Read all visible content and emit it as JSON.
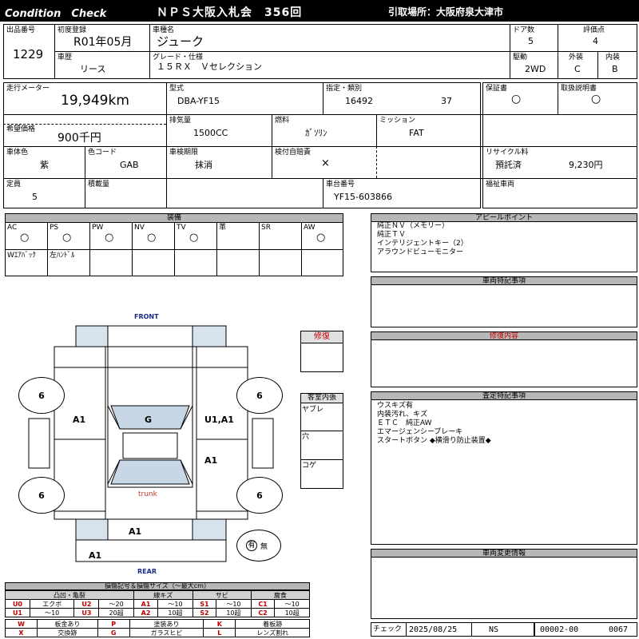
{
  "header": {
    "left": "Condition　Check",
    "center": "ＮＰＳ大阪入札会　356回",
    "right": "引取場所：大阪府泉大津市"
  },
  "info": {
    "lot_label": "出品番号",
    "lot": "1229",
    "first_reg_label": "初度登録",
    "first_reg": "R01年05月",
    "car_name_label": "車種名",
    "car_name": "ジューク",
    "doors_label": "ドア数",
    "doors": "5",
    "grade_score_label": "評価点",
    "grade_score": "4",
    "history_label": "車歴",
    "history": "リース",
    "grade_label": "グレード・仕様",
    "grade": "１５ＲＸ　Ｖセレクション",
    "drive_label": "駆動",
    "drive": "2WD",
    "exterior_label": "外装",
    "exterior": "C",
    "interior_label": "内装",
    "interior": "B",
    "mileage_label": "走行メーター",
    "mileage": "19,949km",
    "model_label": "型式",
    "model": "DBA-YF15",
    "designation_label": "指定・類別",
    "designation": "16492",
    "category": "37",
    "warranty_label": "保証書",
    "warranty": "○",
    "manual_label": "取扱説明書",
    "manual": "○",
    "price_label": "希望価格",
    "price": "900千円",
    "displacement_label": "排気量",
    "displacement": "1500CC",
    "fuel_label": "燃料",
    "fuel": "ｶﾞｿﾘﾝ",
    "mission_label": "ミッション",
    "mission": "FAT",
    "color_label": "車体色",
    "color": "紫",
    "color_code_label": "色コード",
    "color_code": "GAB",
    "inspection_label": "車検期限",
    "inspection": "抹消",
    "liability_label": "検付自賠責",
    "liability": "×",
    "recycle_label": "リサイクル料",
    "recycle_status": "預託済",
    "recycle_fee": "9,230円",
    "capacity_label": "定員",
    "capacity": "5",
    "load_label": "積載量",
    "chassis_label": "車台番号",
    "chassis": "YF15-603866",
    "welfare_label": "福祉車両"
  },
  "equipment": {
    "title": "装備",
    "row1": [
      {
        "label": "AC",
        "val": "○"
      },
      {
        "label": "PS",
        "val": "○"
      },
      {
        "label": "PW",
        "val": "○"
      },
      {
        "label": "NV",
        "val": "○"
      },
      {
        "label": "TV",
        "val": "○"
      },
      {
        "label": "革",
        "val": ""
      },
      {
        "label": "SR",
        "val": ""
      },
      {
        "label": "AW",
        "val": "○"
      }
    ],
    "row2": [
      "Wｴｱﾊﾞｯｸ",
      "左ﾊﾝﾄﾞﾙ",
      "",
      "",
      "",
      "",
      "",
      ""
    ]
  },
  "diagram": {
    "front": "FRONT",
    "rear": "REAR",
    "trunk": "trunk",
    "tires": [
      "6",
      "6",
      "6",
      "6"
    ],
    "marks": {
      "hood_left": "A1",
      "windshield": "G",
      "right_front": "U1,A1",
      "right_rear": "A1",
      "rear_bumper_mid": "A1",
      "rear_bumper_low": "A1"
    },
    "spare_yes": "有",
    "spare_no": "無"
  },
  "repair": {
    "title": "修復"
  },
  "cabin": {
    "title": "客室内張",
    "items": [
      "ヤブレ",
      "穴",
      "コゲ"
    ]
  },
  "appeal": {
    "title": "アピールポイント",
    "lines": [
      "純正ＮＶ（メモリー）",
      "純正ＴＶ",
      "インテリジェントキー（2）",
      "アラウンドビューモニター"
    ]
  },
  "special": {
    "title": "車両特記事項"
  },
  "repair_detail": {
    "title": "修復内容"
  },
  "assessment": {
    "title": "査定特記事項",
    "lines": [
      "ウスキズ有",
      "内装汚れ、キズ",
      "ＥＴＣ　純正AW",
      "エマージェンシーブレーキ",
      "スタートボタン ◆横滑り防止装置◆"
    ]
  },
  "change": {
    "title": "車両変更情報"
  },
  "check": {
    "label": "チェック",
    "date": "2025/08/25",
    "inspector": "NS",
    "code1": "00002-00",
    "code2": "0067"
  },
  "legend": {
    "title": "損傷記号＆損傷サイズ（〜最大cm）",
    "groups": [
      "凸凹・亀裂",
      "線キズ",
      "サビ",
      "腐食"
    ],
    "r1": [
      "U0",
      "エクボ",
      "U2",
      "〜20",
      "A1",
      "〜10",
      "S1",
      "〜10",
      "C1",
      "〜10"
    ],
    "r2": [
      "U1",
      "〜10",
      "U3",
      "20超",
      "A2",
      "10超",
      "S2",
      "10超",
      "C2",
      "10超"
    ],
    "r3": [
      "W",
      "板金あり",
      "P",
      "塗装あり",
      "K",
      "着板跡"
    ],
    "r4": [
      "X",
      "交換跡",
      "G",
      "ガラスヒビ",
      "L",
      "レンズ割れ"
    ]
  }
}
